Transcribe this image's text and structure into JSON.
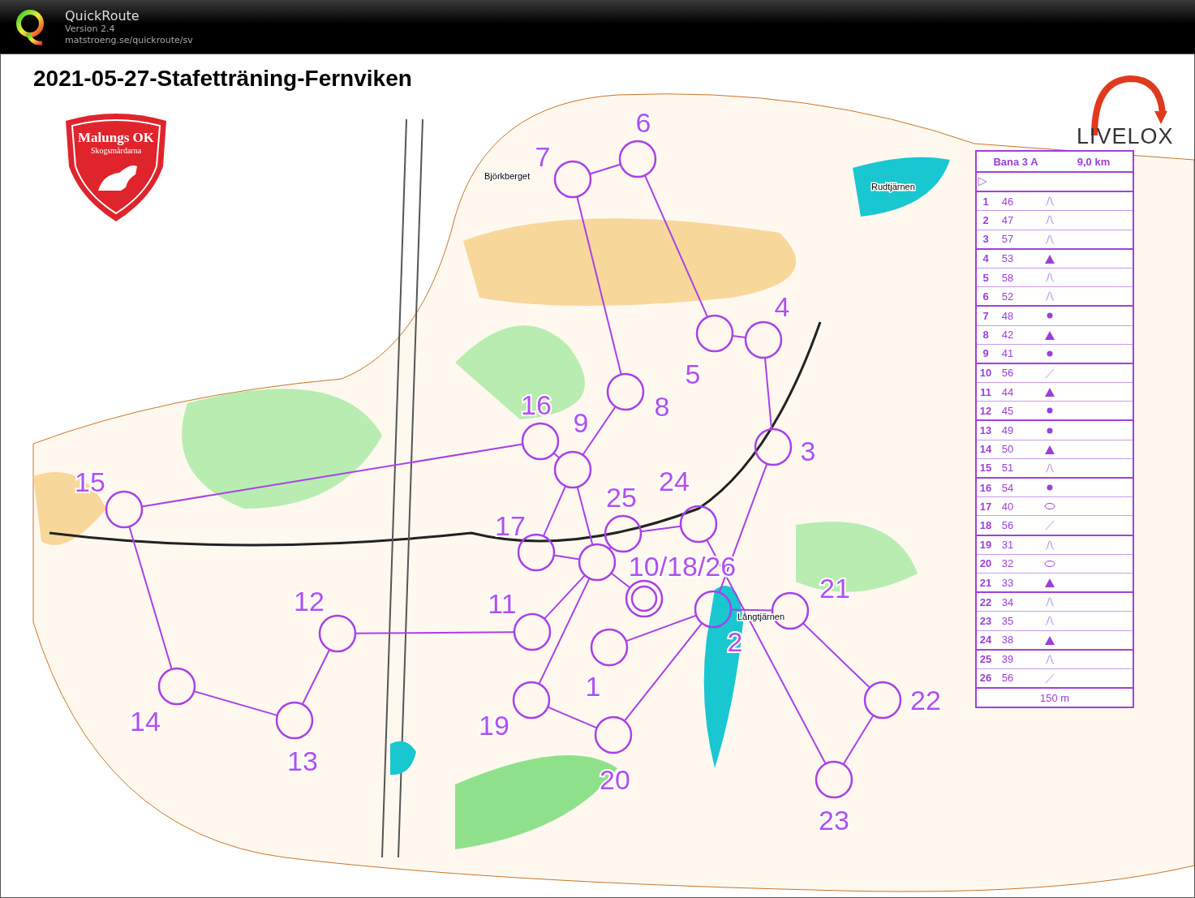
{
  "app": {
    "name": "QuickRoute",
    "version": "Version 2.4",
    "url": "matstroeng.se/quickroute/sv"
  },
  "map": {
    "title": "2021-05-27-Stafetträning-Fernviken",
    "club_logo": {
      "name": "Malungs OK",
      "subtitle": "Skogsmårdarna"
    },
    "brand": "LIVELOX",
    "place_names": [
      "Björkberget",
      "Rudtjärnen",
      "Långtjärnen"
    ],
    "controls": [
      {
        "label": "1"
      },
      {
        "label": "2"
      },
      {
        "label": "3"
      },
      {
        "label": "4"
      },
      {
        "label": "5"
      },
      {
        "label": "6"
      },
      {
        "label": "7"
      },
      {
        "label": "8"
      },
      {
        "label": "9"
      },
      {
        "label": "10/18/26"
      },
      {
        "label": "11"
      },
      {
        "label": "12"
      },
      {
        "label": "13"
      },
      {
        "label": "14"
      },
      {
        "label": "15"
      },
      {
        "label": "16"
      },
      {
        "label": "17"
      },
      {
        "label": "19"
      },
      {
        "label": "20"
      },
      {
        "label": "21"
      },
      {
        "label": "22"
      },
      {
        "label": "23"
      },
      {
        "label": "24"
      },
      {
        "label": "25"
      }
    ],
    "descriptions": {
      "course": "Bana 3 A",
      "length": "9,0 km",
      "footer": "150 m",
      "rows": [
        {
          "number": "1",
          "code": "46",
          "kind": "other"
        },
        {
          "number": "2",
          "code": "47",
          "kind": "other"
        },
        {
          "number": "3",
          "code": "57",
          "kind": "other"
        },
        {
          "number": "4",
          "code": "53",
          "kind": "triangle"
        },
        {
          "number": "5",
          "code": "58",
          "kind": "other"
        },
        {
          "number": "6",
          "code": "52",
          "kind": "other"
        },
        {
          "number": "7",
          "code": "48",
          "kind": "dot"
        },
        {
          "number": "8",
          "code": "42",
          "kind": "triangle"
        },
        {
          "number": "9",
          "code": "41",
          "kind": "dot"
        },
        {
          "number": "10",
          "code": "56",
          "kind": "lines"
        },
        {
          "number": "11",
          "code": "44",
          "kind": "triangle"
        },
        {
          "number": "12",
          "code": "45",
          "kind": "dot"
        },
        {
          "number": "13",
          "code": "49",
          "kind": "dot"
        },
        {
          "number": "14",
          "code": "50",
          "kind": "triangle"
        },
        {
          "number": "15",
          "code": "51",
          "kind": "other"
        },
        {
          "number": "16",
          "code": "54",
          "kind": "dot"
        },
        {
          "number": "17",
          "code": "40",
          "kind": "oval"
        },
        {
          "number": "18",
          "code": "56",
          "kind": "lines"
        },
        {
          "number": "19",
          "code": "31",
          "kind": "other"
        },
        {
          "number": "20",
          "code": "32",
          "kind": "oval"
        },
        {
          "number": "21",
          "code": "33",
          "kind": "triangle"
        },
        {
          "number": "22",
          "code": "34",
          "kind": "other"
        },
        {
          "number": "23",
          "code": "35",
          "kind": "other"
        },
        {
          "number": "24",
          "code": "38",
          "kind": "triangle"
        },
        {
          "number": "25",
          "code": "39",
          "kind": "other"
        },
        {
          "number": "26",
          "code": "56",
          "kind": "lines"
        }
      ]
    }
  }
}
